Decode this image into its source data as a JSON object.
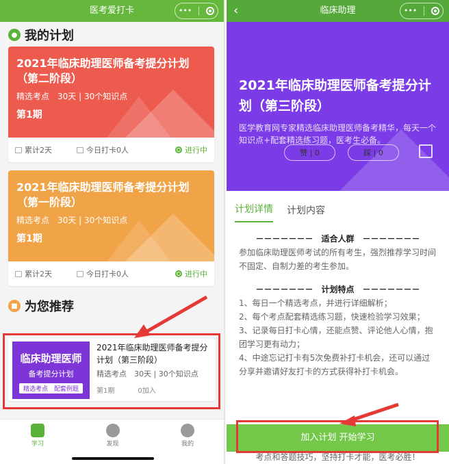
{
  "left": {
    "title": "医考爱打卡",
    "capsule": {
      "more": "•••"
    },
    "my_plans_title": "我的计划",
    "plans": [
      {
        "title": "2021年临床助理医师备考提分计划（第二阶段）",
        "meta": "精选考点　30天 | 30个知识点",
        "period": "第1期",
        "total": "累计2天",
        "today": "今日打卡0人",
        "status": "进行中"
      },
      {
        "title": "2021年临床助理医师备考提分计划（第一阶段）",
        "meta": "精选考点　30天 | 30个知识点",
        "period": "第1期",
        "total": "累计2天",
        "today": "今日打卡0人",
        "status": "进行中"
      }
    ],
    "recommend_title": "为您推荐",
    "recommend": {
      "thumb_title": "临床助理医师",
      "thumb_sub": "备考提分计划",
      "thumb_tag": "精选考点　配套例题",
      "title": "2021年临床助理医师备考提分计划（第三阶段）",
      "meta": "精选考点　30天 | 30个知识点",
      "period": "第1期",
      "joined": "0加入"
    },
    "tabs": [
      {
        "label": "学习",
        "icon": "book-icon",
        "active": true
      },
      {
        "label": "发现",
        "icon": "compass-icon",
        "active": false
      },
      {
        "label": "我的",
        "icon": "user-icon",
        "active": false
      }
    ]
  },
  "right": {
    "title": "临床助理",
    "capsule": {
      "more": "•••"
    },
    "hero_title": "2021年临床助理医师备考提分计划（第三阶段）",
    "hero_desc": "医学教育网专家精选临床助理医师备考精华，每天一个知识点+配套精选练习题，医考生必备。",
    "like": "赞 | 0",
    "dislike": "踩 | 0",
    "tabs": [
      "计划详情",
      "计划内容"
    ],
    "sections": [
      {
        "heading": "－－－－－－－　适合人群　－－－－－－－",
        "lines": [
          "参加临床助理医师考试的所有考生，强烈推荐学习时间不固定、自制力差的考生参加。"
        ]
      },
      {
        "heading": "－－－－－－－　计划特点　－－－－－－－",
        "lines": [
          "1、每日一个精选考点，并进行详细解析；",
          "2、每个考点配套精选练习题，快速检验学习效果；",
          "3、记录每日打卡心情，还能点赞、评论他人心情，抱团学习更有动力；",
          "4、中途忘记打卡有5次免费补打卡机会，还可以通过分享并邀请好友打卡的方式获得补打卡机会。"
        ]
      }
    ],
    "join_button": "加入计划 开始学习",
    "tail": "考点和答题技巧，坚持打卡才能，医考必胜！"
  },
  "colors": {
    "green": "#5ab238",
    "red_card": "#ed5a4e",
    "orange_card": "#f1a347",
    "purple": "#7b3ce8",
    "highlight": "#e53935"
  }
}
